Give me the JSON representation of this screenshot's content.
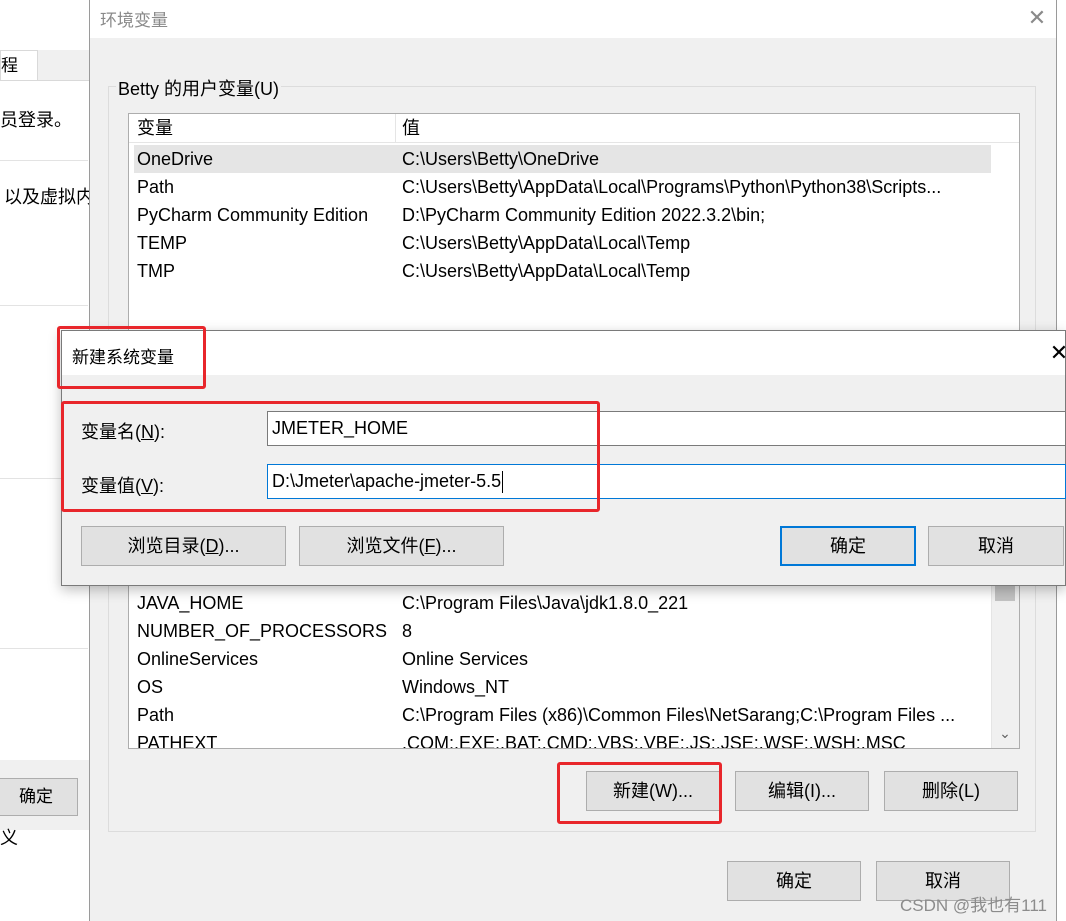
{
  "background_window": {
    "tab_label": "程",
    "line1": "员登录。",
    "line2": "以及虚拟内",
    "ok_label": "确定",
    "bottom_glyph": "义"
  },
  "env_dialog": {
    "title": "环境变量",
    "user_group_label": "Betty 的用户变量(U)",
    "columns": [
      "变量",
      "值"
    ],
    "user_vars": [
      {
        "name": "OneDrive",
        "value": "C:\\Users\\Betty\\OneDrive"
      },
      {
        "name": "Path",
        "value": "C:\\Users\\Betty\\AppData\\Local\\Programs\\Python\\Python38\\Scripts..."
      },
      {
        "name": "PyCharm Community Edition",
        "value": "D:\\PyCharm Community Edition 2022.3.2\\bin;"
      },
      {
        "name": "TEMP",
        "value": "C:\\Users\\Betty\\AppData\\Local\\Temp"
      },
      {
        "name": "TMP",
        "value": "C:\\Users\\Betty\\AppData\\Local\\Temp"
      }
    ],
    "system_vars": [
      {
        "name": "JAVA_HOME",
        "value": "C:\\Program Files\\Java\\jdk1.8.0_221"
      },
      {
        "name": "NUMBER_OF_PROCESSORS",
        "value": "8"
      },
      {
        "name": "OnlineServices",
        "value": "Online Services"
      },
      {
        "name": "OS",
        "value": "Windows_NT"
      },
      {
        "name": "Path",
        "value": "C:\\Program Files (x86)\\Common Files\\NetSarang;C:\\Program Files ..."
      },
      {
        "name": "PATHEXT",
        "value": ".COM;.EXE;.BAT;.CMD;.VBS;.VBE;.JS;.JSE;.WSF;.WSH;.MSC"
      }
    ],
    "buttons": {
      "new": "新建(W)...",
      "edit": "编辑(I)...",
      "delete": "删除(L)",
      "ok": "确定",
      "cancel": "取消"
    }
  },
  "new_var_dialog": {
    "title": "新建系统变量",
    "name_label_pre": "变量名(",
    "name_label_key": "N",
    "name_label_post": "):",
    "value_label_pre": "变量值(",
    "value_label_key": "V",
    "value_label_post": "):",
    "name_value": "JMETER_HOME",
    "value_value": "D:\\Jmeter\\apache-jmeter-5.5",
    "browse_dir_pre": "浏览目录(",
    "browse_dir_key": "D",
    "browse_dir_post": ")...",
    "browse_file_pre": "浏览文件(",
    "browse_file_key": "F",
    "browse_file_post": ")...",
    "ok": "确定",
    "cancel": "取消"
  },
  "watermark": "CSDN @我也有111",
  "colors": {
    "highlight": "#e8262b",
    "focus": "#0078d7",
    "window_bg": "#f0f0f0"
  }
}
